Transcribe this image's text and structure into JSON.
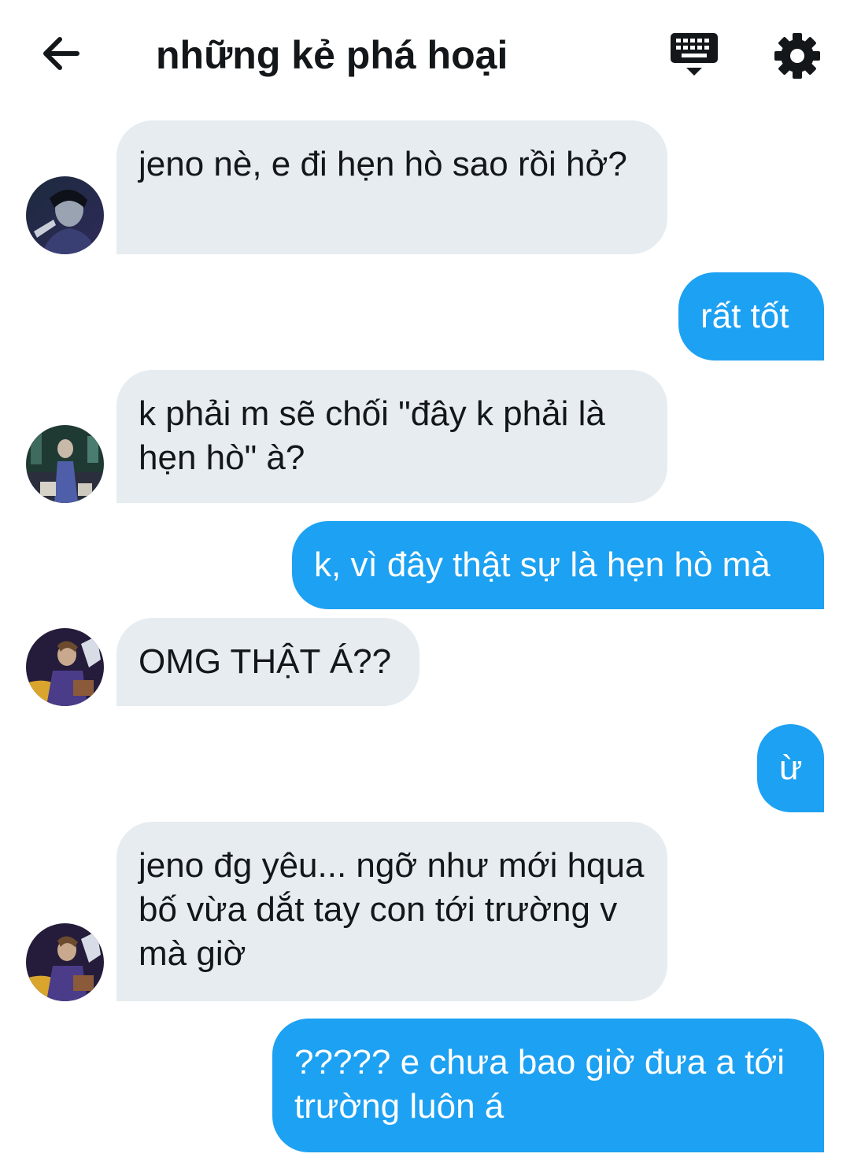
{
  "header": {
    "title": "những kẻ phá hoại",
    "back_icon": "arrow-left-icon",
    "keyboard_icon": "keyboard-icon",
    "settings_icon": "gear-icon"
  },
  "messages": [
    {
      "direction": "in",
      "text": "jeno nè, e đi hẹn hò sao rồi hở?",
      "avatar": "avatar-1"
    },
    {
      "direction": "out",
      "text": "rất tốt"
    },
    {
      "direction": "in",
      "text": "k phải m sẽ chối \"đây k phải là hẹn hò\" à?",
      "avatar": "avatar-2"
    },
    {
      "direction": "out",
      "text": "k, vì đây thật sự là hẹn hò mà"
    },
    {
      "direction": "in",
      "text": "OMG THẬT Á??",
      "avatar": "avatar-3"
    },
    {
      "direction": "out",
      "text": "ừ"
    },
    {
      "direction": "in",
      "text": "jeno đg yêu... ngỡ như mới hqua bố vừa dắt tay con tới trường v mà giờ",
      "avatar": "avatar-3"
    },
    {
      "direction": "out",
      "text": "????? e chưa bao giờ đưa a tới trường luôn á"
    }
  ],
  "colors": {
    "incoming_bubble": "#e6ecf0",
    "outgoing_bubble": "#1da1f2",
    "text_dark": "#14171a",
    "text_light": "#ffffff"
  }
}
